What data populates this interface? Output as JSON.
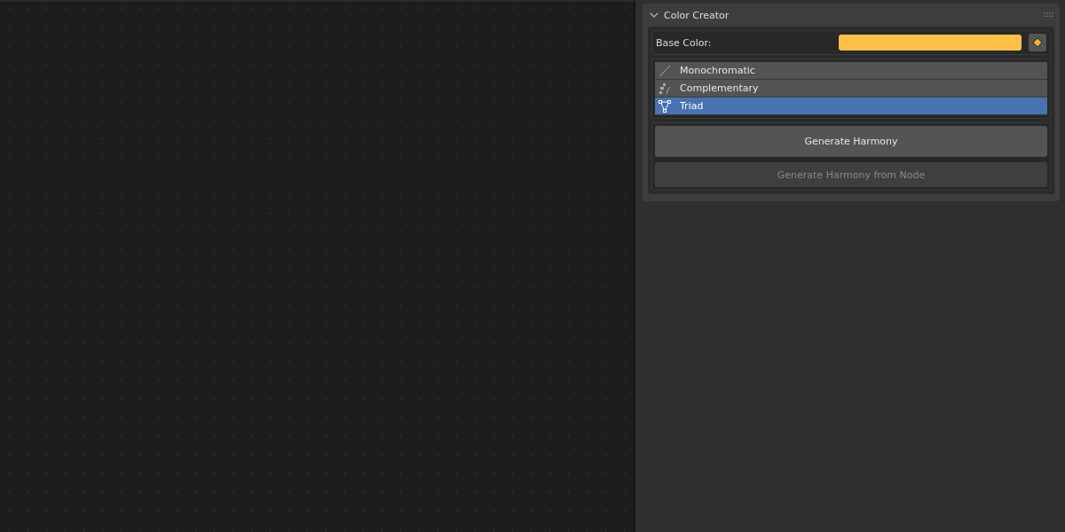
{
  "panel": {
    "title": "Color Creator",
    "expanded": true
  },
  "base_color": {
    "label": "Base Color:",
    "color": "#ffc145"
  },
  "harmonies": [
    {
      "label": "Monochromatic",
      "kind": "line",
      "selected": false
    },
    {
      "label": "Complementary",
      "kind": "steps",
      "selected": false
    },
    {
      "label": "Triad",
      "kind": "triangle",
      "selected": true
    }
  ],
  "buttons": [
    {
      "label": "Generate Harmony",
      "disabled": false
    },
    {
      "label": "Generate Harmony from Node",
      "disabled": true
    }
  ]
}
